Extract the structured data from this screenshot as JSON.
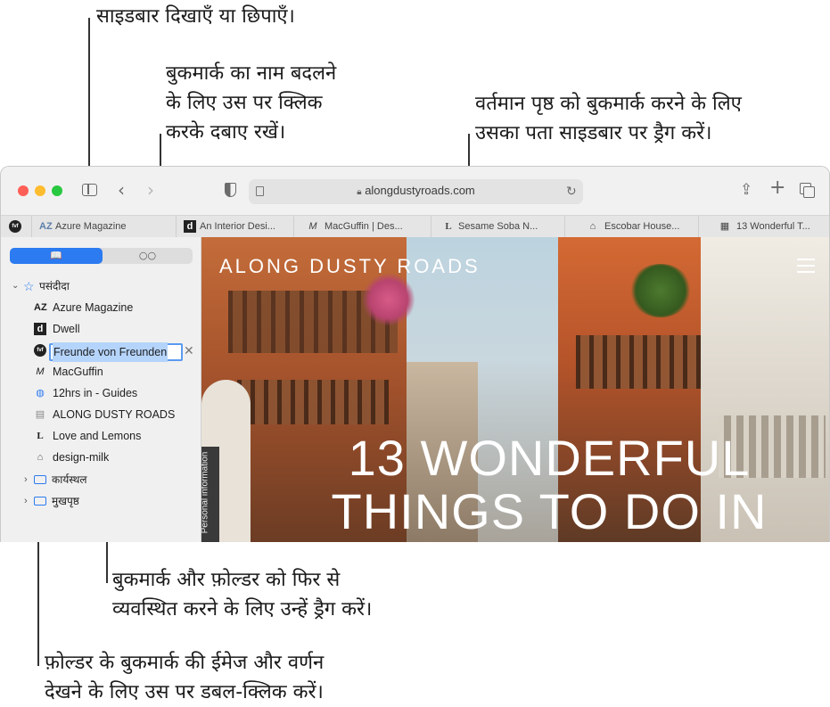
{
  "callouts": {
    "sidebar_toggle": "साइडबार दिखाएँ या छिपाएँ।",
    "rename": "बुकमार्क का नाम बदलने\nके लिए उस पर क्लिक\nकरके दबाए रखें।",
    "drag_page": "वर्तमान पृष्ठ को बुकमार्क करने के लिए\nउसका पता साइडबार पर ड्रैग करें।",
    "reorder": "बुकमार्क और फ़ोल्डर को फिर से\nव्यवस्थित करने के लिए उन्हें ड्रैग करें।",
    "double_click": "फ़ोल्डर के बुकमार्क की ईमेज और वर्णन\nदेखने के लिए उस पर डबल-क्लिक करें।"
  },
  "toolbar": {
    "address": "alongdustyroads.com",
    "icons": [
      "sidebar-icon",
      "back-icon",
      "forward-icon",
      "privacy-shield-icon",
      "reader-icon",
      "lock-icon",
      "reload-icon",
      "share-icon",
      "new-tab-icon",
      "tab-overview-icon"
    ]
  },
  "tabs": [
    {
      "fav": "fvf",
      "label": ""
    },
    {
      "fav": "AZ",
      "label": "Azure Magazine"
    },
    {
      "fav": "d",
      "label": "An Interior Desi..."
    },
    {
      "fav": "M",
      "label": "MacGuffin | Des..."
    },
    {
      "fav": "L",
      "label": "Sesame Soba N..."
    },
    {
      "fav": "⌂",
      "label": "Escobar House..."
    },
    {
      "fav": "▦",
      "label": "13 Wonderful T..."
    }
  ],
  "sidebar": {
    "seg_bookmarks": "📖",
    "seg_reading": "○○",
    "favorites_label": "पसंदीदा",
    "items": [
      {
        "fav": "AZ",
        "label": "Azure Magazine"
      },
      {
        "fav": "d",
        "label": "Dwell"
      },
      {
        "fav": "fvf",
        "label": "Freunde von Freunden"
      },
      {
        "fav": "M",
        "label": "MacGuffin"
      },
      {
        "fav": "◍",
        "label": "12hrs in - Guides"
      },
      {
        "fav": "▤",
        "label": "ALONG DUSTY ROADS"
      },
      {
        "fav": "L",
        "label": "Love and Lemons"
      },
      {
        "fav": "⌂",
        "label": "design-milk"
      }
    ],
    "folders": [
      "कार्यस्थल",
      "मुखपृष्ठ"
    ]
  },
  "page": {
    "logo": "ALONG DUSTY ROADS",
    "headline": "13 WONDERFUL\nTHINGS TO DO IN",
    "side_tab": "Personal information"
  },
  "colors": {
    "accent": "#2c7bf0",
    "close": "#fe5f57",
    "minimize": "#febc2e",
    "zoom": "#28c840"
  }
}
